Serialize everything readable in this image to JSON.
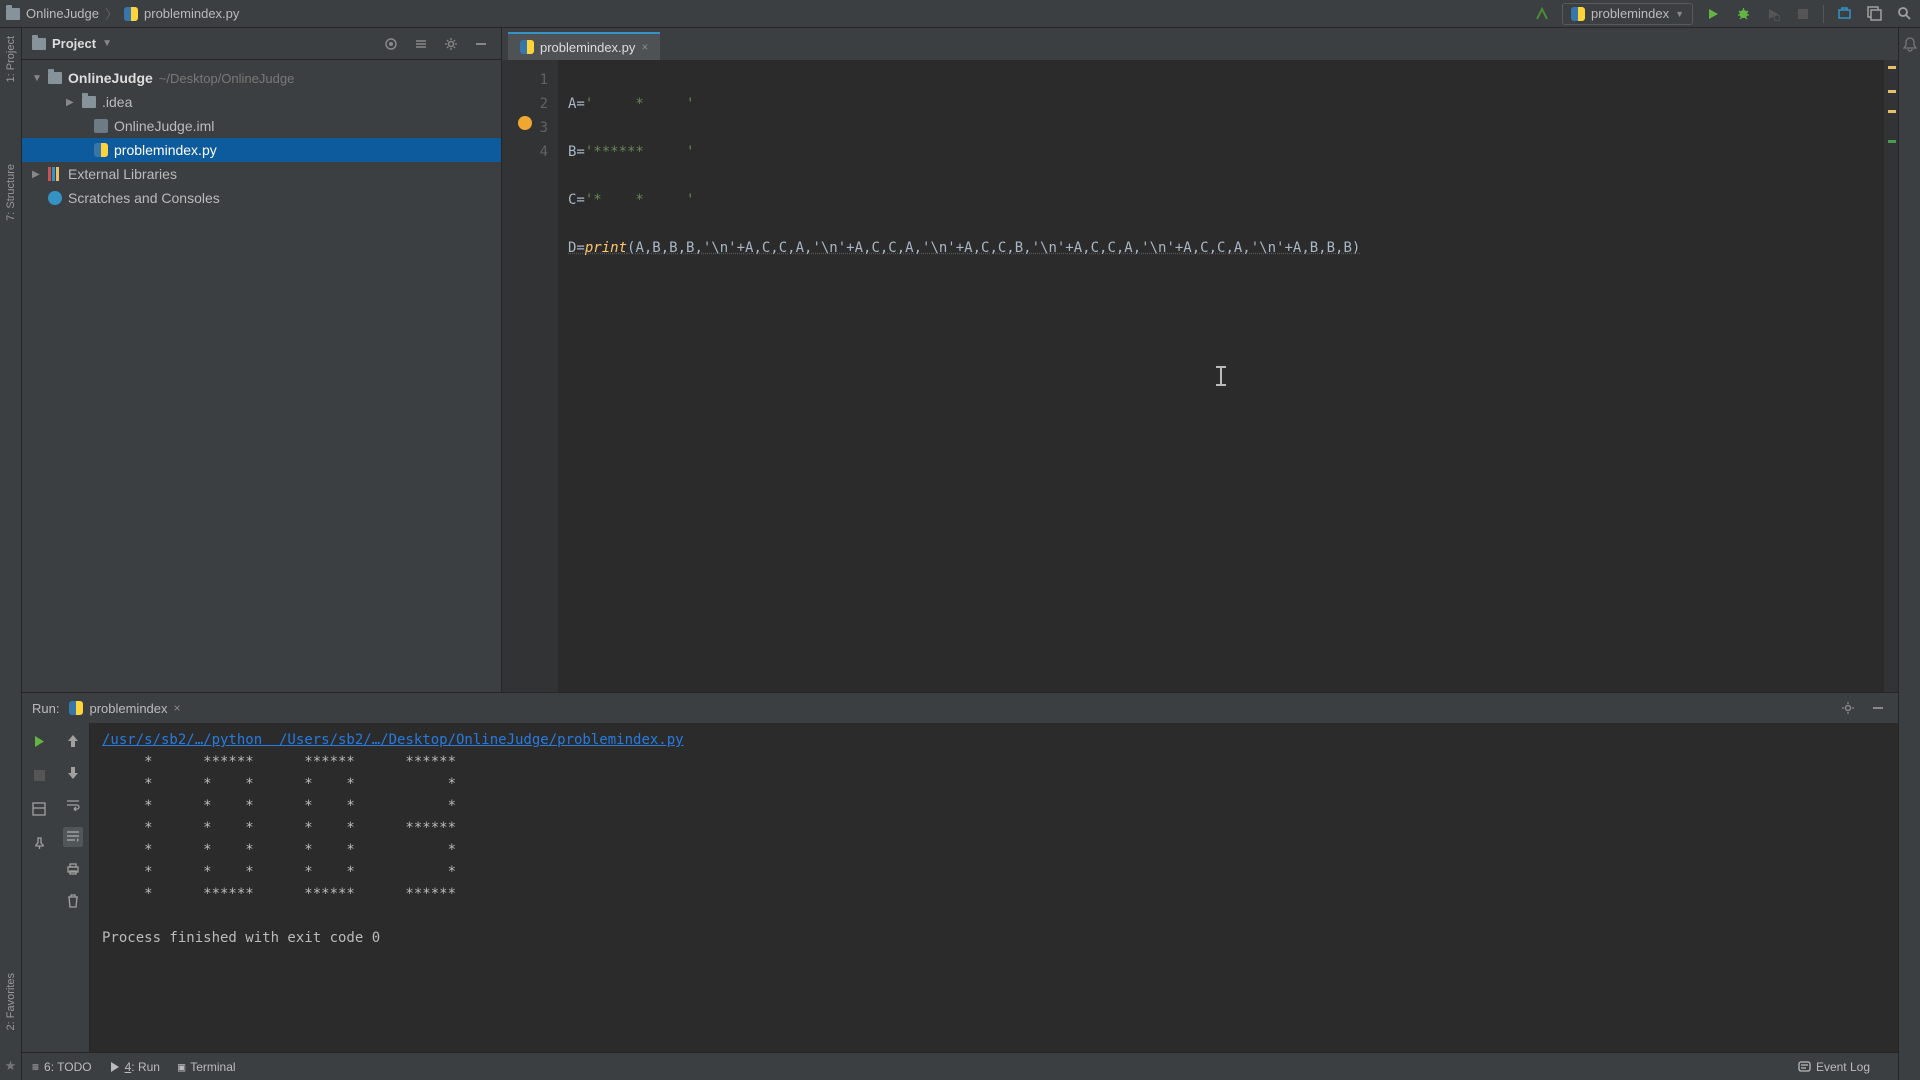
{
  "breadcrumb": {
    "project": "OnlineJudge",
    "file": "problemindex.py"
  },
  "run_config_selector": "problemindex",
  "left_rail": {
    "project": "1: Project",
    "structure": "7: Structure",
    "favorites": "2: Favorites"
  },
  "project_panel": {
    "title": "Project",
    "root": {
      "name": "OnlineJudge",
      "path": "~/Desktop/OnlineJudge"
    },
    "idea_folder": ".idea",
    "iml_file": "OnlineJudge.iml",
    "py_file": "problemindex.py",
    "ext_libs": "External Libraries",
    "scratches": "Scratches and Consoles"
  },
  "editor": {
    "tab": "problemindex.py",
    "lines": {
      "l1": {
        "n": "1",
        "prefix": "A=",
        "str": "'     *     '"
      },
      "l2": {
        "n": "2",
        "prefix": "B=",
        "str": "'******     '"
      },
      "l3": {
        "n": "3",
        "prefix": "C=",
        "str": "'*    *     '"
      },
      "l4": {
        "n": "4",
        "prefix": "D=",
        "fn": "print",
        "args": "(A,B,B,B,'\\n'+A,C,C,A,'\\n'+A,C,C,A,'\\n'+A,C,C,B,'\\n'+A,C,C,A,'\\n'+A,C,C,A,'\\n'+A,B,B,B)"
      }
    }
  },
  "run": {
    "label": "Run:",
    "config": "problemindex",
    "command_line": "/usr/s/sb2/…/python  /Users/sb2/…/Desktop/OnlineJudge/problemindex.py",
    "output": "     *      ******      ******      ******     \n     *      *    *      *    *           *     \n     *      *    *      *    *           *     \n     *      *    *      *    *      ******     \n     *      *    *      *    *           *     \n     *      *    *      *    *           *     \n     *      ******      ******      ******     ",
    "exit": "Process finished with exit code 0"
  },
  "bottom": {
    "todo": "6: TODO",
    "run": "Run",
    "run_key": "4",
    "terminal": "Terminal",
    "event_log": "Event Log"
  }
}
